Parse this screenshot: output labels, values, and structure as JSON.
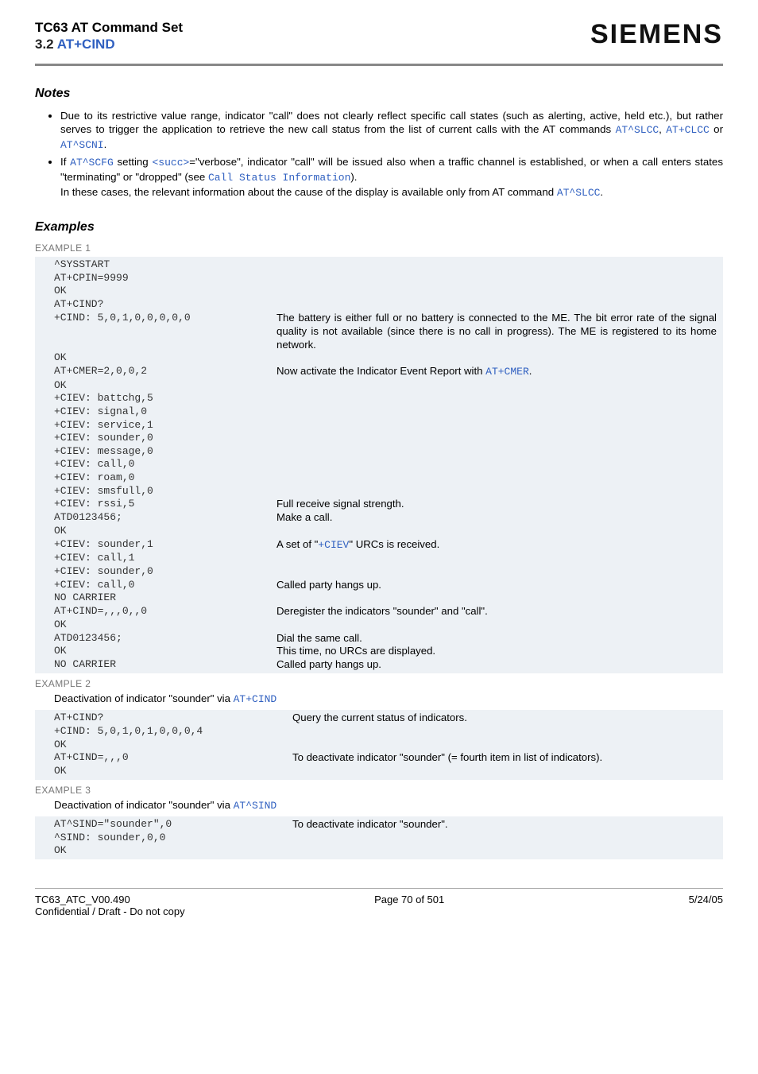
{
  "header": {
    "title": "TC63 AT Command Set",
    "section_num": "3.2 ",
    "section_cmd": "AT+CIND",
    "brand": "SIEMENS"
  },
  "notes_heading": "Notes",
  "notes": {
    "n1a": "Due to its restrictive value range, indicator \"call\" does not clearly reflect specific call states (such as alerting, active, held etc.), but rather serves to trigger the application to retrieve the new call status from the list of current calls with the AT commands ",
    "n1_c1": "AT^SLCC",
    "n1_sep1": ", ",
    "n1_c2": "AT+CLCC",
    "n1_sep2": " or ",
    "n1_c3": "AT^SCNI",
    "n1_end": ".",
    "n2a": "If ",
    "n2_c1": "AT^SCFG",
    "n2b": " setting ",
    "n2_c2": "<succ>",
    "n2c": "=\"verbose\", indicator \"call\" will be issued also when a traffic channel is established, or when a call enters states \"terminating\" or \"dropped\" (see ",
    "n2_c3": "Call Status Information",
    "n2d": ").",
    "n2e": "In these cases, the relevant information about the cause of the display is available only from AT command ",
    "n2_c4": "AT^SLCC",
    "n2f": "."
  },
  "examples_heading": "Examples",
  "ex1_label": "EXAMPLE 1",
  "ex1": [
    {
      "cmd": "^SYSSTART",
      "desc": ""
    },
    {
      "cmd": "AT+CPIN=9999",
      "desc": ""
    },
    {
      "cmd": "OK",
      "desc": ""
    },
    {
      "cmd": "AT+CIND?",
      "desc": ""
    },
    {
      "cmd": "+CIND: 5,0,1,0,0,0,0,0",
      "desc": "The battery is either full or no battery is connected to the ME. The bit error rate of the signal quality is not available (since there is no call in progress). The ME is registered to its home network."
    },
    {
      "cmd": "OK",
      "desc": ""
    },
    {
      "cmd": "AT+CMER=2,0,0,2",
      "desc_pre": "Now activate the Indicator Event Report with ",
      "desc_link": "AT+CMER",
      "desc_post": "."
    },
    {
      "cmd": "OK",
      "desc": ""
    },
    {
      "cmd": "+CIEV: battchg,5",
      "desc": ""
    },
    {
      "cmd": "+CIEV: signal,0",
      "desc": ""
    },
    {
      "cmd": "+CIEV: service,1",
      "desc": ""
    },
    {
      "cmd": "+CIEV: sounder,0",
      "desc": ""
    },
    {
      "cmd": "+CIEV: message,0",
      "desc": ""
    },
    {
      "cmd": "+CIEV: call,0",
      "desc": ""
    },
    {
      "cmd": "+CIEV: roam,0",
      "desc": ""
    },
    {
      "cmd": "+CIEV: smsfull,0",
      "desc": ""
    },
    {
      "cmd": "+CIEV: rssi,5",
      "desc": "Full receive signal strength."
    },
    {
      "cmd": "ATD0123456;",
      "desc": "Make a call."
    },
    {
      "cmd": "OK",
      "desc": ""
    },
    {
      "cmd": "+CIEV: sounder,1",
      "desc_pre": "A set of \"",
      "desc_link": "+CIEV",
      "desc_post": "\" URCs is received."
    },
    {
      "cmd": "+CIEV: call,1",
      "desc": ""
    },
    {
      "cmd": "+CIEV: sounder,0",
      "desc": ""
    },
    {
      "cmd": "+CIEV: call,0",
      "desc": "Called party hangs up."
    },
    {
      "cmd": "NO CARRIER",
      "desc": ""
    },
    {
      "cmd": "AT+CIND=,,,0,,0",
      "desc": "Deregister the indicators \"sounder\" and \"call\"."
    },
    {
      "cmd": "OK",
      "desc": ""
    },
    {
      "cmd": "ATD0123456;",
      "desc": "Dial the same call."
    },
    {
      "cmd": "OK",
      "desc": "This time, no URCs are displayed."
    },
    {
      "cmd": "NO CARRIER",
      "desc": "Called party hangs up."
    }
  ],
  "ex2_label": "EXAMPLE 2",
  "ex2_intro_pre": "Deactivation of indicator \"sounder\" via ",
  "ex2_intro_link": "AT+CIND",
  "ex2": [
    {
      "cmd": "AT+CIND?",
      "desc": "Query the current status of indicators."
    },
    {
      "cmd": "+CIND: 5,0,1,0,1,0,0,0,4",
      "desc": ""
    },
    {
      "cmd": "OK",
      "desc": ""
    },
    {
      "cmd": "AT+CIND=,,,0",
      "desc": "To deactivate indicator \"sounder\" (= fourth item in list of indicators)."
    },
    {
      "cmd": "OK",
      "desc": ""
    }
  ],
  "ex3_label": "EXAMPLE 3",
  "ex3_intro_pre": "Deactivation of indicator \"sounder\" via ",
  "ex3_intro_link": "AT^SIND",
  "ex3": [
    {
      "cmd": "AT^SIND=\"sounder\",0",
      "desc": "To deactivate indicator \"sounder\"."
    },
    {
      "cmd": "^SIND: sounder,0,0",
      "desc": ""
    },
    {
      "cmd": "OK",
      "desc": ""
    }
  ],
  "footer": {
    "left": "TC63_ATC_V00.490",
    "center": "Page 70 of 501",
    "right": "5/24/05",
    "line2": "Confidential / Draft - Do not copy"
  }
}
